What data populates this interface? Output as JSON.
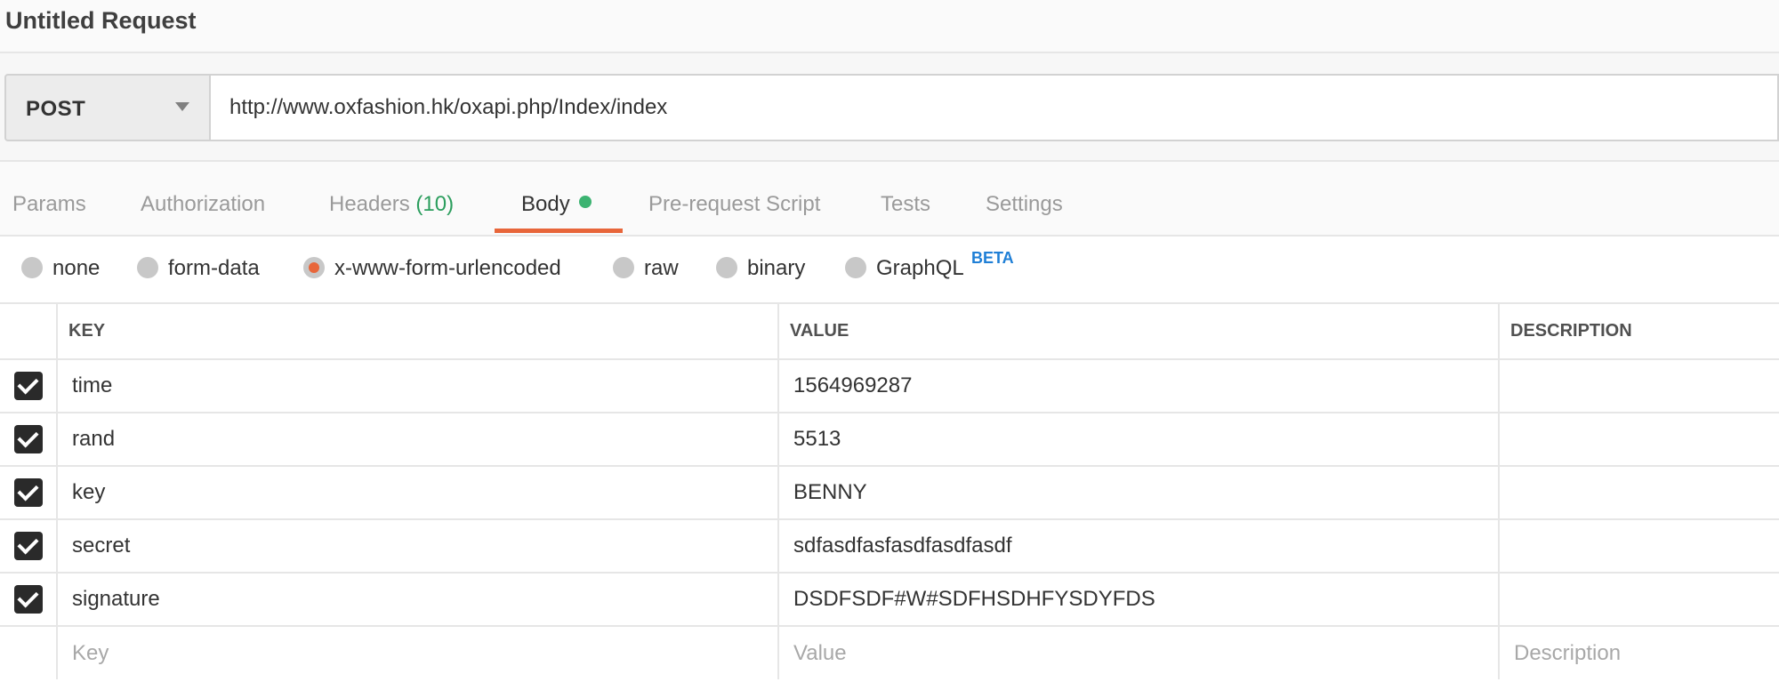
{
  "request": {
    "title": "Untitled Request",
    "method": "POST",
    "url": "http://www.oxfashion.hk/oxapi.php/Index/index"
  },
  "tabs": [
    {
      "label": "Params"
    },
    {
      "label": "Authorization"
    },
    {
      "label": "Headers",
      "count": "(10)"
    },
    {
      "label": "Body",
      "active": true
    },
    {
      "label": "Pre-request Script"
    },
    {
      "label": "Tests"
    },
    {
      "label": "Settings"
    }
  ],
  "body_types": {
    "selected": "x-www-form-urlencoded",
    "options": [
      "none",
      "form-data",
      "x-www-form-urlencoded",
      "raw",
      "binary",
      "GraphQL"
    ],
    "beta_badge": "BETA"
  },
  "table": {
    "headers": {
      "key": "KEY",
      "value": "VALUE",
      "description": "DESCRIPTION"
    },
    "rows": [
      {
        "checked": true,
        "key": "time",
        "value": "1564969287",
        "description": ""
      },
      {
        "checked": true,
        "key": "rand",
        "value": "5513",
        "description": ""
      },
      {
        "checked": true,
        "key": "key",
        "value": "BENNY",
        "description": ""
      },
      {
        "checked": true,
        "key": "secret",
        "value": "sdfasdfasfasdfasdfasdf",
        "description": ""
      },
      {
        "checked": true,
        "key": "signature",
        "value": "DSDFSDF#W#SDFHSDHFYSDYFDS",
        "description": ""
      }
    ],
    "placeholders": {
      "key": "Key",
      "value": "Value",
      "description": "Description"
    }
  },
  "colors": {
    "accent": "#e8663a",
    "status_dot": "#3cb371",
    "count": "#2c9e5e",
    "beta": "#1f7fd6"
  }
}
